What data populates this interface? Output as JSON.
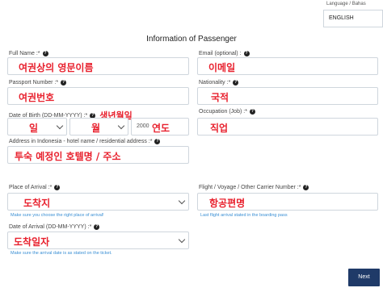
{
  "header": {
    "language_label": "Language / Bahas",
    "language_selected": "ENGLISH"
  },
  "form": {
    "title": "Information of Passenger",
    "full_name": {
      "label": "Full Name :*",
      "value": "여권상의 영문이름"
    },
    "email": {
      "label": "Email (optional) :",
      "value": "이메일"
    },
    "passport": {
      "label": "Passport Number :*",
      "value": "여권번호"
    },
    "nationality": {
      "label": "Nationality :*",
      "value": "국적"
    },
    "dob": {
      "label": "Date of Birth (DD-MM-YYYY) :*",
      "annotation": "생년월일",
      "day": "일",
      "month": "월",
      "year_value": "2000",
      "year_annotation": "연도"
    },
    "occupation": {
      "label": "Occupation (Job) :*",
      "value": "직업"
    },
    "address": {
      "label": "Address in Indonesia - hotel name / residential address :*",
      "value": "투숙 예정인 호텔명 / 주소"
    },
    "place_of_arrival": {
      "label": "Place of Arrival :*",
      "value": "도착지",
      "hint": "Make sure you choose the right place of arrival!"
    },
    "flight": {
      "label": "Flight / Voyage / Other Carrier Number :*",
      "value": "항공편명",
      "hint": "Last flight arrival stated in the boarding pass"
    },
    "date_of_arrival": {
      "label": "Date of Arrival (DD-MM-YYYY) :*",
      "value": "도착일자",
      "hint": "Make sure the arrival date is as stated on the ticket."
    },
    "next_label": "Next"
  },
  "icons": {
    "help": "question-circle-icon",
    "dropdown": "chevron-down-icon"
  }
}
